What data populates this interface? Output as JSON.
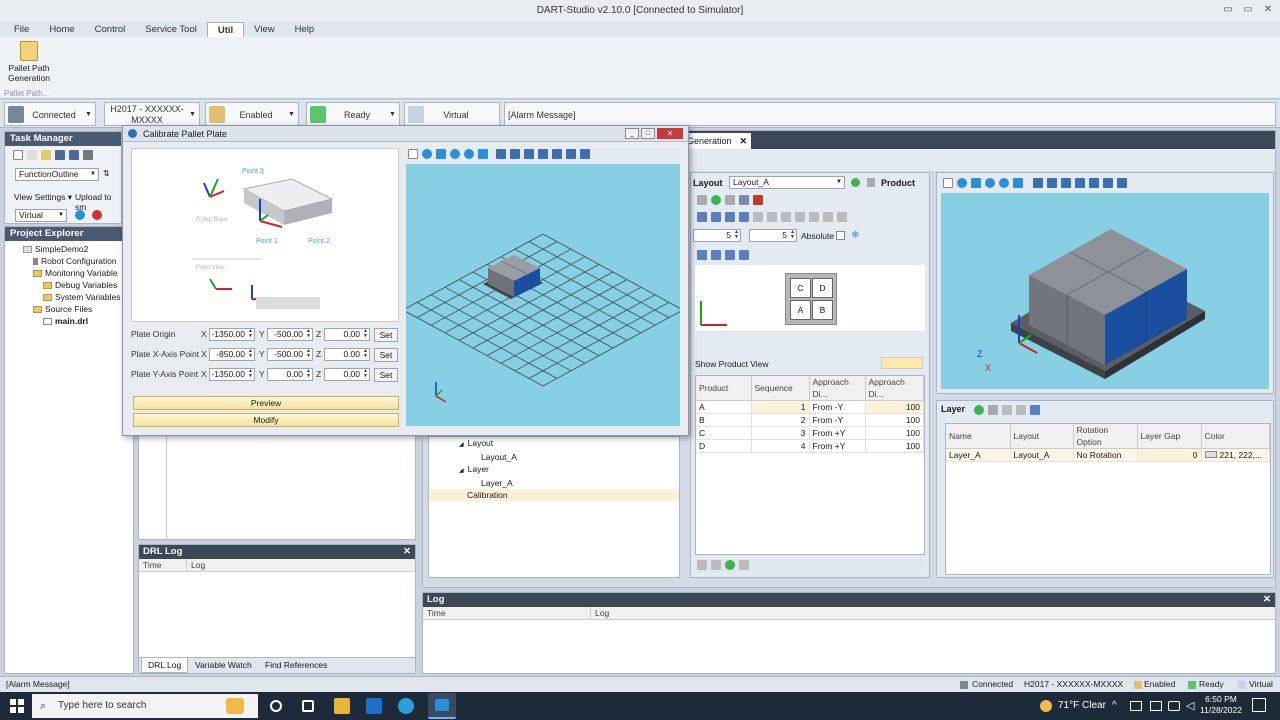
{
  "window": {
    "title": "DART-Studio v2.10.0 [Connected to Simulator]"
  },
  "menu": [
    "File",
    "Home",
    "Control",
    "Service Tool",
    "Util",
    "View",
    "Help"
  ],
  "menu_active": "Util",
  "ribbon": {
    "button_label": "Pallet Path Generation",
    "group_label": "Pallet Path..."
  },
  "status_bar_top": {
    "connection": "Connected",
    "robot": "H2017 - XXXXXX-MXXXX",
    "servo": "Enabled",
    "state": "Ready",
    "mode": "Virtual",
    "alarm": "[Alarm Message]"
  },
  "task_manager": {
    "title": "Task Manager",
    "function_select": "FunctionOutline",
    "view_settings": "View Settings",
    "upload": "Upload to sm",
    "mode_select": "Virtual"
  },
  "project_explorer": {
    "title": "Project Explorer",
    "project": "SimpleDemo2",
    "items": [
      "Robot Configuration",
      "Monitoring Variable",
      "Debug Variables",
      "System Variables",
      "Source Files",
      "main.drl"
    ]
  },
  "drl_log": {
    "title": "DRL Log",
    "col_time": "Time",
    "col_log": "Log",
    "tabs": [
      "DRL Log",
      "Variable Watch",
      "Find References"
    ]
  },
  "log": {
    "title": "Log",
    "col_time": "Time",
    "col_log": "Log"
  },
  "dialog": {
    "title": "Calibrate Pallet Plate",
    "diagram": {
      "point3": "Point 3",
      "point1": "Point 1",
      "point2": "Point 2",
      "robot_base": "Robot Base",
      "front_view": "Front View"
    },
    "rows": [
      {
        "label": "Plate Origin",
        "x": "-1350.00",
        "y": "-500.00",
        "z": "0.00"
      },
      {
        "label": "Plate X-Axis Point",
        "x": "-850.00",
        "y": "-500.00",
        "z": "0.00"
      },
      {
        "label": "Plate Y-Axis Point",
        "x": "-1350.00",
        "y": "0.00",
        "z": "0.00"
      }
    ],
    "axis_x": "X",
    "axis_y": "Y",
    "axis_z": "Z",
    "set_label": "Set",
    "preview_label": "Preview",
    "modify_label": "Modify"
  },
  "pallet_tab": {
    "label": "Generation"
  },
  "layout_panel": {
    "layout_label": "Layout",
    "layout_value": "Layout_A",
    "product_label": "Product",
    "rows_value": "5",
    "cols_value": "5",
    "absolute_label": "Absolute",
    "show_product_view": "Show Product View",
    "cells": [
      "C",
      "D",
      "A",
      "B"
    ]
  },
  "tree_bottom": {
    "items": [
      "Layout",
      "Layout_A",
      "Layer",
      "Layer_A",
      "Calibration"
    ]
  },
  "product_table": {
    "headers": [
      "Product",
      "Sequence",
      "Approach Di...",
      "Approach Di..."
    ],
    "rows": [
      [
        "A",
        "1",
        "From -Y",
        "100"
      ],
      [
        "B",
        "2",
        "From -Y",
        "100"
      ],
      [
        "C",
        "3",
        "From +Y",
        "100"
      ],
      [
        "D",
        "4",
        "From +Y",
        "100"
      ]
    ]
  },
  "layer_panel": {
    "title": "Layer",
    "headers": [
      "Name",
      "Layout",
      "Rotation Option",
      "Layer Gap",
      "Color"
    ],
    "rows": [
      [
        "Layer_A",
        "Layout_A",
        "No Rotation",
        "0",
        "221, 222,..."
      ]
    ]
  },
  "status_bar_bottom": {
    "alarm": "[Alarm Message]",
    "connection": "Connected",
    "robot": "H2017 - XXXXXX-MXXXX",
    "servo": "Enabled",
    "state": "Ready",
    "mode": "Virtual"
  },
  "taskbar": {
    "search_placeholder": "Type here to search",
    "weather": "71°F  Clear",
    "time": "6:50 PM",
    "date": "11/28/2022"
  },
  "colors": {
    "accent": "#4a5a70",
    "viewport": "#87cfe2",
    "box_gray": "#8a8f96",
    "box_blue": "#1a4fa0"
  }
}
